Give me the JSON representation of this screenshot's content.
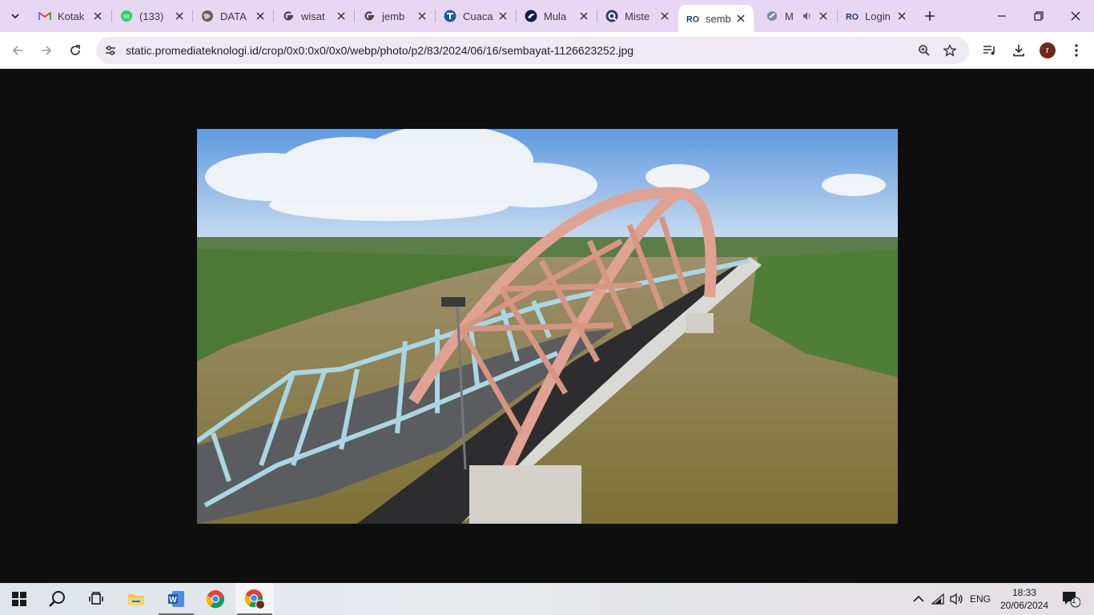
{
  "browser": {
    "tabs": [
      {
        "title": "Kotak",
        "icon": "gmail-icon",
        "active": false
      },
      {
        "title": "(133)",
        "icon": "whatsapp-icon",
        "active": false
      },
      {
        "title": "DATA",
        "icon": "globe-icon",
        "active": false
      },
      {
        "title": "wisat",
        "icon": "google-icon",
        "active": false
      },
      {
        "title": "jemb",
        "icon": "google-icon",
        "active": false
      },
      {
        "title": "Cuaca",
        "icon": "tempo-icon",
        "active": false
      },
      {
        "title": "Mula",
        "icon": "bird-icon",
        "active": false
      },
      {
        "title": "Miste",
        "icon": "q-icon",
        "active": false
      },
      {
        "title": "semb",
        "icon": "ro-icon",
        "active": true
      },
      {
        "title": "M",
        "icon": "site-icon",
        "active": false,
        "audio": true
      },
      {
        "title": "Login",
        "icon": "ro-icon",
        "active": false
      }
    ],
    "url": "static.promediateknologi.id/crop/0x0:0x0/0x0/webp/photo/p2/83/2024/06/16/sembayat-1126623252.jpg",
    "profile_initial": "r"
  },
  "taskbar": {
    "language": "ENG",
    "time": "18:33",
    "date": "20/06/2024",
    "notification_count": "1"
  },
  "colors": {
    "tabstrip": "#e8d7f2",
    "omnibox": "#efe9f3",
    "viewer_bg": "#0e0e0e",
    "bridge_arch": "#e0a292"
  }
}
